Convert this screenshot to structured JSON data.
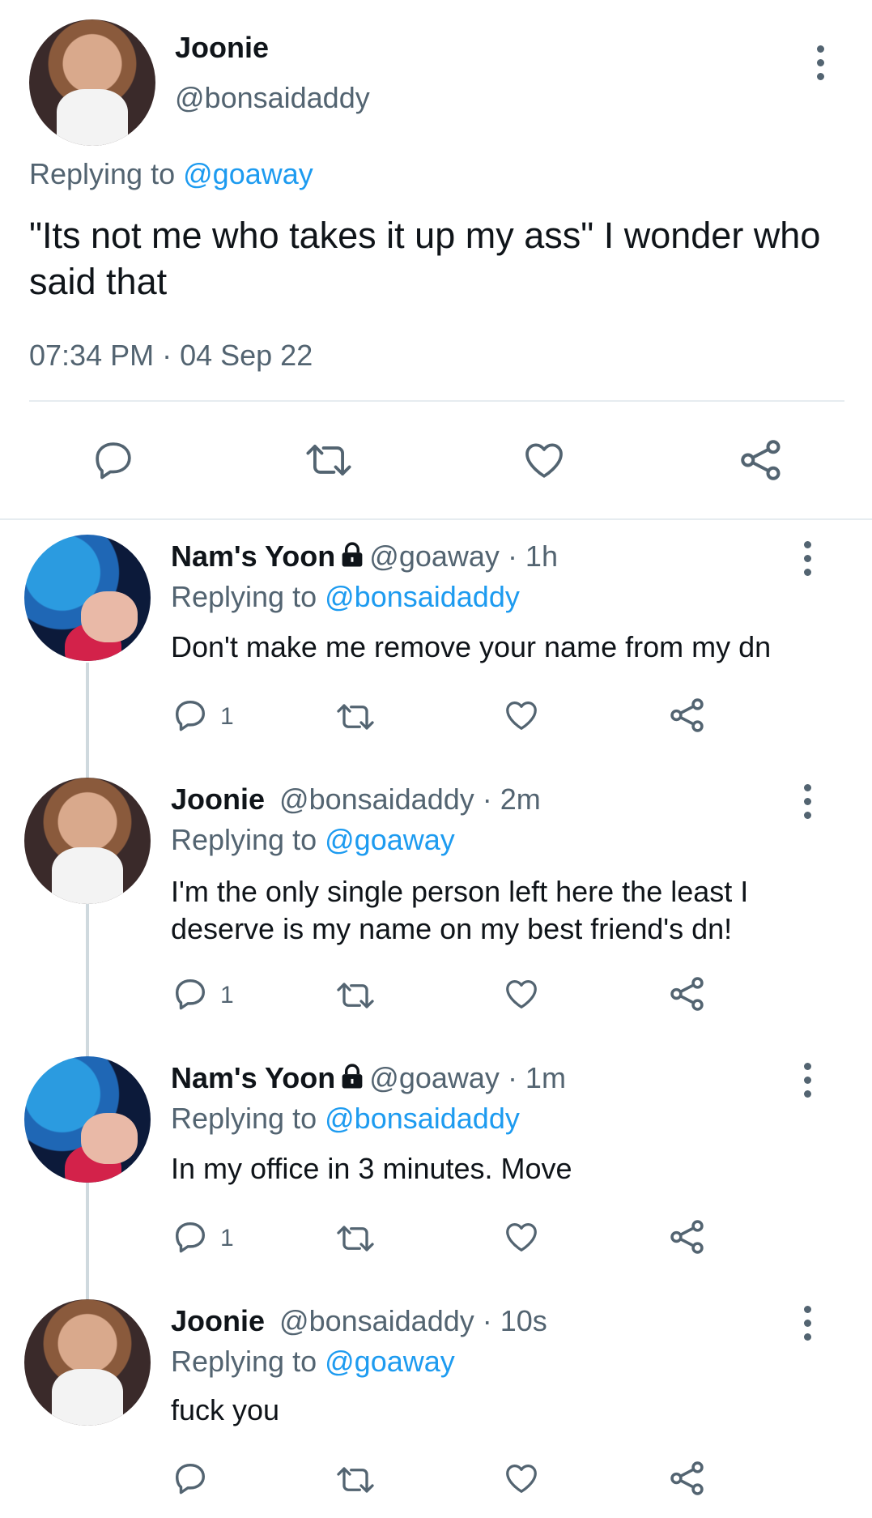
{
  "main_tweet": {
    "author_name": "Joonie",
    "handle": "@bonsaidaddy",
    "replying_to_prefix": "Replying to",
    "replying_to_handle": "@goaway",
    "text": "\"Its not me who takes it up my ass\" I wonder who said that",
    "timestamp": "07:34 PM · 04 Sep 22"
  },
  "replies": [
    {
      "author_name": "Nam's Yoon",
      "handle": "@goaway",
      "time": "· 1h",
      "replying_to_prefix": "Replying to",
      "replying_to_handle": "@bonsaidaddy",
      "text": "Don't make me remove your name from my dn",
      "reply_count": "1"
    },
    {
      "author_name": "Joonie",
      "handle": "@bonsaidaddy",
      "time": "· 2m",
      "replying_to_prefix": "Replying to",
      "replying_to_handle": "@goaway",
      "text_line1": "I'm the only single person left here the least I",
      "text_line2": "deserve is my name on my best friend's dn!",
      "reply_count": "1"
    },
    {
      "author_name": "Nam's Yoon",
      "handle": "@goaway",
      "time": "· 1m",
      "replying_to_prefix": "Replying to",
      "replying_to_handle": "@bonsaidaddy",
      "text": "In my office in 3 minutes. Move",
      "reply_count": "1"
    },
    {
      "author_name": "Joonie",
      "handle": "@bonsaidaddy",
      "time": "· 10s",
      "replying_to_prefix": "Replying to",
      "replying_to_handle": "@goaway",
      "text": "fuck you",
      "reply_count": ""
    }
  ],
  "icons": [
    "comment-icon",
    "retweet-icon",
    "like-icon",
    "share-icon",
    "more-options-icon",
    "lock-icon"
  ],
  "colors": {
    "link": "#1d9bf0",
    "muted": "#536471",
    "text": "#0f1419",
    "divider": "#e6ecf0"
  }
}
